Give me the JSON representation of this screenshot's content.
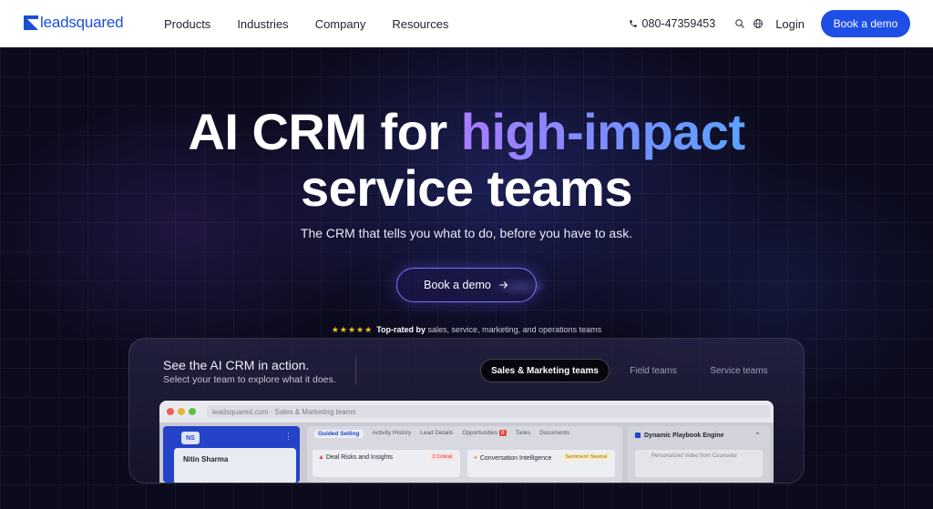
{
  "nav": {
    "logo_text": "leadsquared",
    "menu": [
      {
        "label": "Products"
      },
      {
        "label": "Industries"
      },
      {
        "label": "Company"
      },
      {
        "label": "Resources"
      }
    ],
    "phone": "080-47359453",
    "phone_icon": "phone-icon",
    "search_icon": "search-icon",
    "globe_icon": "globe-icon",
    "login": "Login",
    "cta": "Book a demo"
  },
  "hero": {
    "title_plain": "AI CRM for",
    "title_highlight": "high-impact",
    "title_line2": "service teams",
    "subtitle": "The CRM that tells you what to do, before you have to ask.",
    "cta": "Book a demo",
    "rating_stars": "★★★★★",
    "rating_bold": "Top-rated by",
    "rating_rest": "sales, service, marketing, and operations teams"
  },
  "card": {
    "title": "See the AI CRM in action.",
    "subtitle": "Select your team to explore what it does.",
    "tabs": [
      {
        "label": "Sales & Marketing teams",
        "active": true
      },
      {
        "label": "Field teams",
        "active": false
      },
      {
        "label": "Service teams",
        "active": false
      }
    ]
  },
  "preview": {
    "url": "leadsquared.com · Sales & Marketing teams",
    "avatar_initials": "NS",
    "contact_name": "Nitin Sharma",
    "tabs": [
      {
        "label": "Guided Selling"
      },
      {
        "label": "Activity History"
      },
      {
        "label": "Lead Details"
      },
      {
        "label": "Opportunities",
        "badge": "8"
      },
      {
        "label": "Tasks"
      },
      {
        "label": "Documents"
      }
    ],
    "panel_left": {
      "title": "Deal Risks and Insights",
      "tag": "2 Critical"
    },
    "panel_mid": {
      "title": "Conversation Intelligence",
      "tag": "Sentiment: Neutral"
    },
    "right_title": "Dynamic Playbook Engine",
    "right_item": "Personalized Video from Counselor"
  },
  "colors": {
    "brand_blue": "#1d4ee6",
    "gradient_start": "#a97cff",
    "gradient_end": "#5aa2ff",
    "star": "#f3c623"
  }
}
